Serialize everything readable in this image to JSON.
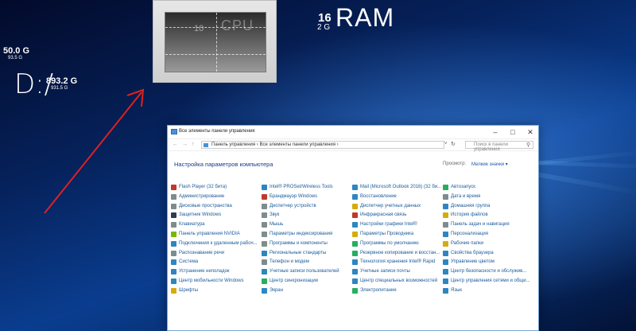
{
  "cpu": {
    "label": "CPU",
    "cores": "10"
  },
  "ram": {
    "total": "16",
    "unit": "2 G",
    "label": "RAM"
  },
  "drive_c": {
    "free": "50.0 G",
    "total": "93.5 G"
  },
  "drive_d": {
    "letter": "D:/",
    "free": "893.2 G",
    "total": "931.5 G"
  },
  "window": {
    "title": "Все элементы панели управления",
    "address": "Панель управления  ›  Все элементы панели управления  ›",
    "search_placeholder": "Поиск в панели управления",
    "heading": "Настройка параметров компьютера",
    "view_label": "Просмотр:",
    "view_value": "Мелкие значки ▾"
  },
  "columns": [
    {
      "items": [
        {
          "label": "Flash Player (32 бита)",
          "color": "#c0392b"
        },
        {
          "label": "Администрирование",
          "color": "#7f8c8d"
        },
        {
          "label": "Дисковые пространства",
          "color": "#7f8c8d"
        },
        {
          "label": "Защитник Windows",
          "color": "#2c3e50"
        },
        {
          "label": "Клавиатура",
          "color": "#7f8c8d"
        },
        {
          "label": "Панель управления NVIDIA",
          "color": "#76b900"
        },
        {
          "label": "Подключения к удаленным рабоч...",
          "color": "#2e86c1"
        },
        {
          "label": "Распознавание речи",
          "color": "#7f8c8d"
        },
        {
          "label": "Система",
          "color": "#2e86c1"
        },
        {
          "label": "Устранение неполадок",
          "color": "#2e86c1"
        },
        {
          "label": "Центр мобильности Windows",
          "color": "#2e86c1"
        },
        {
          "label": "Шрифты",
          "color": "#d4ac0d"
        }
      ]
    },
    {
      "items": [
        {
          "label": "Intel® PROSet/Wireless Tools",
          "color": "#2e86c1"
        },
        {
          "label": "Брандмауэр Windows",
          "color": "#c0392b"
        },
        {
          "label": "Диспетчер устройств",
          "color": "#7f8c8d"
        },
        {
          "label": "Звук",
          "color": "#7f8c8d"
        },
        {
          "label": "Мышь",
          "color": "#7f8c8d"
        },
        {
          "label": "Параметры индексирования",
          "color": "#7f8c8d"
        },
        {
          "label": "Программы и компоненты",
          "color": "#7f8c8d"
        },
        {
          "label": "Региональные стандарты",
          "color": "#2e86c1"
        },
        {
          "label": "Телефон и модем",
          "color": "#7f8c8d"
        },
        {
          "label": "Учетные записи пользователей",
          "color": "#2e86c1"
        },
        {
          "label": "Центр синхронизации",
          "color": "#27ae60"
        },
        {
          "label": "Экран",
          "color": "#2e86c1"
        }
      ]
    },
    {
      "items": [
        {
          "label": "Mail (Microsoft Outlook 2016) (32 би...",
          "color": "#2e86c1"
        },
        {
          "label": "Восстановление",
          "color": "#2e86c1"
        },
        {
          "label": "Диспетчер учетных данных",
          "color": "#d4ac0d"
        },
        {
          "label": "Инфракрасная связь",
          "color": "#c0392b"
        },
        {
          "label": "Настройки графики Intel®",
          "color": "#2e86c1"
        },
        {
          "label": "Параметры Проводника",
          "color": "#d4ac0d"
        },
        {
          "label": "Программы по умолчанию",
          "color": "#27ae60"
        },
        {
          "label": "Резервное копирование и восстан...",
          "color": "#27ae60"
        },
        {
          "label": "Технология хранения Intel® Rapid",
          "color": "#2e86c1"
        },
        {
          "label": "Учетные записи почты",
          "color": "#2e86c1"
        },
        {
          "label": "Центр специальных возможностей",
          "color": "#2e86c1"
        },
        {
          "label": "Электропитание",
          "color": "#27ae60"
        }
      ]
    },
    {
      "items": [
        {
          "label": "Автозапуск",
          "color": "#27ae60"
        },
        {
          "label": "Дата и время",
          "color": "#7f8c8d"
        },
        {
          "label": "Домашняя группа",
          "color": "#2e86c1"
        },
        {
          "label": "История файлов",
          "color": "#d4ac0d"
        },
        {
          "label": "Панель задач и навигация",
          "color": "#7f8c8d"
        },
        {
          "label": "Персонализация",
          "color": "#2e86c1"
        },
        {
          "label": "Рабочие папки",
          "color": "#d4ac0d"
        },
        {
          "label": "Свойства браузера",
          "color": "#2e86c1"
        },
        {
          "label": "Управление цветом",
          "color": "#2e86c1"
        },
        {
          "label": "Центр безопасности и обслужив...",
          "color": "#2e86c1"
        },
        {
          "label": "Центр управления сетями и общи...",
          "color": "#2e86c1"
        },
        {
          "label": "Язык",
          "color": "#2e86c1"
        }
      ]
    }
  ]
}
